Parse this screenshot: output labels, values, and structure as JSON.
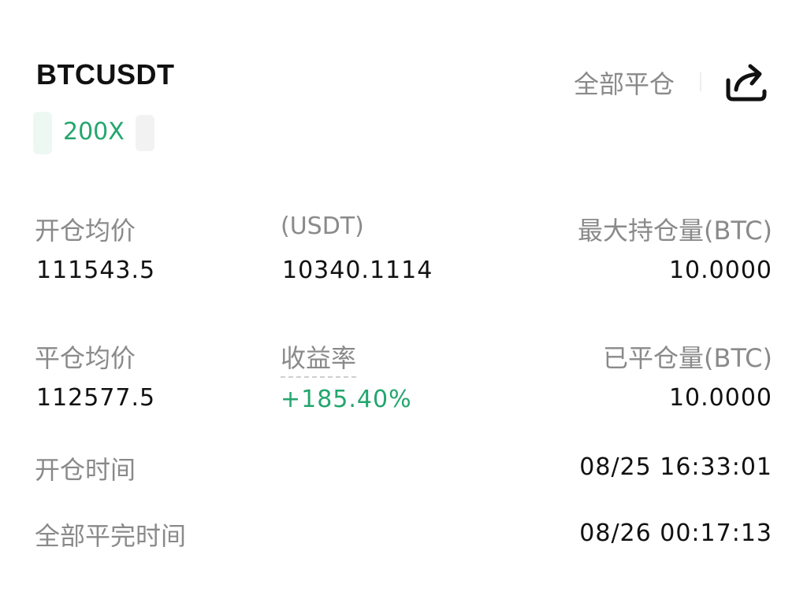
{
  "header": {
    "symbol": "BTCUSDT",
    "close_all_label": "全部平仓",
    "share_icon": "share-icon"
  },
  "tag": {
    "leverage": "200X"
  },
  "stats": {
    "open_avg_price": {
      "label": "开仓均价",
      "value": "111543.5"
    },
    "usdt": {
      "label": "(USDT)",
      "value": "10340.1114"
    },
    "max_position": {
      "label": "最大持仓量(BTC)",
      "value": "10.0000"
    },
    "close_avg_price": {
      "label": "平仓均价",
      "value": "112577.5"
    },
    "return_rate": {
      "label": "收益率",
      "value": "+185.40%"
    },
    "closed_amount": {
      "label": "已平仓量(BTC)",
      "value": "10.0000"
    },
    "open_time": {
      "label": "开仓时间",
      "value": "08/25 16:33:01"
    },
    "close_all_time": {
      "label": "全部平完时间",
      "value": "08/26 00:17:13"
    }
  },
  "colors": {
    "accent_green": "#23a66e",
    "label_gray": "#8a8a8a",
    "text": "#111111"
  }
}
